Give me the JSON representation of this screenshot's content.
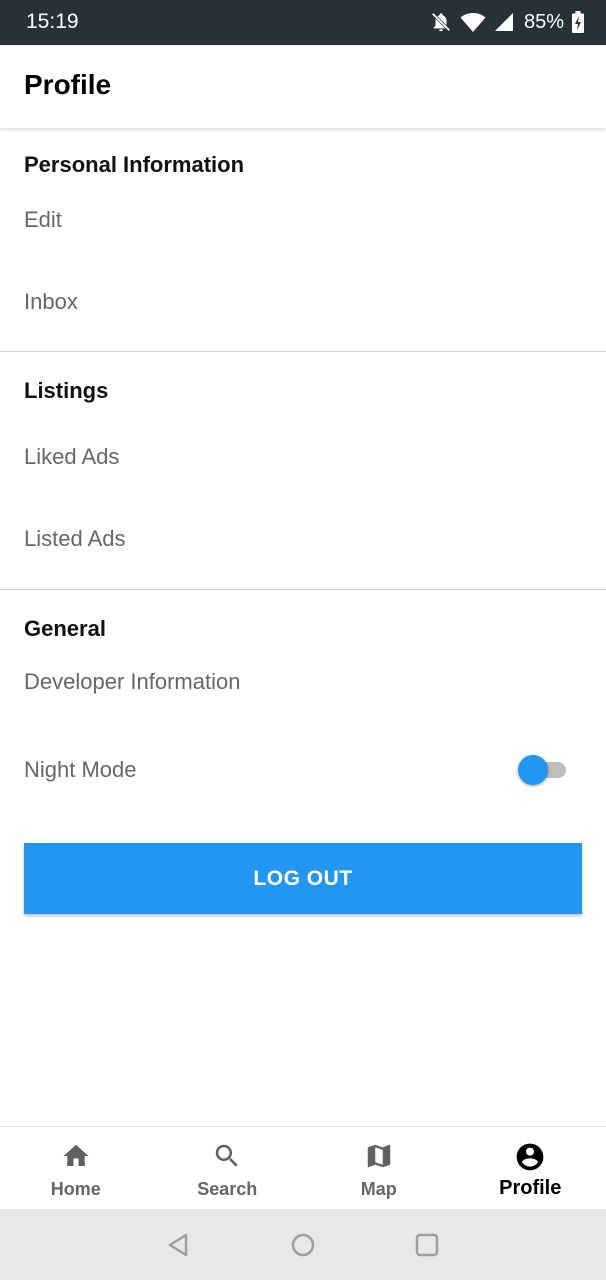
{
  "status_bar": {
    "time": "15:19",
    "battery": "85%",
    "icons": [
      "notifications-off-icon",
      "wifi-icon",
      "cell-signal-icon",
      "battery-charging-icon"
    ]
  },
  "header": {
    "title": "Profile"
  },
  "sections": {
    "personal": {
      "title": "Personal Information",
      "items": [
        {
          "label": "Edit"
        },
        {
          "label": "Inbox"
        }
      ]
    },
    "listings": {
      "title": "Listings",
      "items": [
        {
          "label": "Liked Ads"
        },
        {
          "label": "Listed Ads"
        }
      ]
    },
    "general": {
      "title": "General",
      "items": [
        {
          "label": "Developer Information"
        },
        {
          "label": "Night Mode"
        }
      ]
    }
  },
  "night_mode_toggle": {
    "state": "off"
  },
  "logout": {
    "label": "LOG OUT"
  },
  "bottom_nav": {
    "items": [
      {
        "label": "Home",
        "icon": "home-icon"
      },
      {
        "label": "Search",
        "icon": "search-icon"
      },
      {
        "label": "Map",
        "icon": "map-icon"
      },
      {
        "label": "Profile",
        "icon": "account-circle-icon",
        "active": true
      }
    ]
  },
  "system_nav": {
    "icons": [
      "back-icon",
      "home-circle-icon",
      "recents-icon"
    ]
  },
  "colors": {
    "accent": "#2196F3",
    "status_bar": "#263238",
    "item_text": "#666666",
    "system_nav_bg": "#e8e8e8"
  }
}
